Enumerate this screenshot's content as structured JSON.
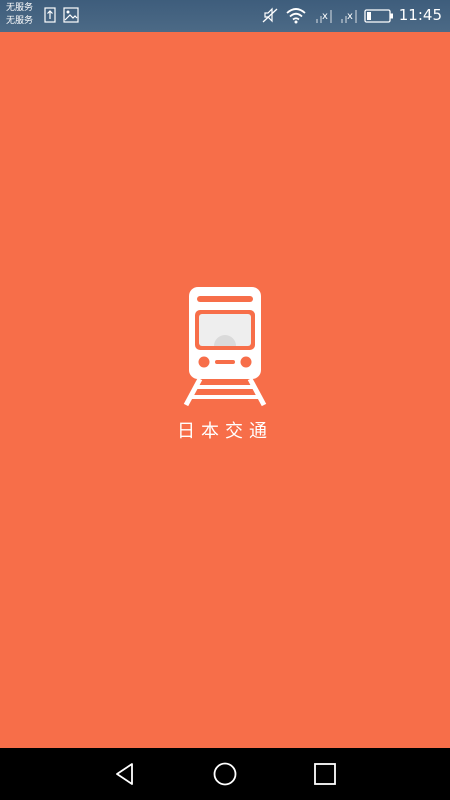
{
  "status_bar": {
    "carrier_line_1": "无服务",
    "carrier_line_2": "无服务",
    "network_1": "x",
    "network_2": "x",
    "time": "11:45",
    "icons": [
      "upload-icon",
      "image-icon",
      "mute-icon",
      "wifi-icon",
      "signal-icon",
      "signal-icon",
      "battery-icon"
    ]
  },
  "splash": {
    "logo_icon": "train-icon",
    "app_name": "日本交通",
    "background_color": "#F76E49"
  },
  "nav_bar": {
    "buttons": [
      "back-icon",
      "home-icon",
      "recents-icon"
    ]
  }
}
